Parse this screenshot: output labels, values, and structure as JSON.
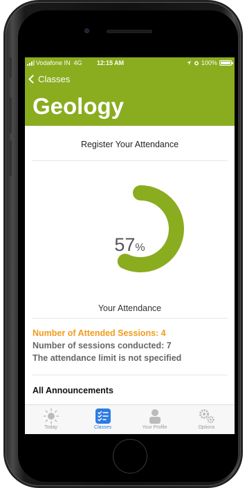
{
  "status_bar": {
    "carrier": "Vodafone IN",
    "network": "4G",
    "time": "12:15 AM",
    "battery": "100%"
  },
  "nav": {
    "back_label": "Classes"
  },
  "header": {
    "title": "Geology"
  },
  "register_label": "Register Your Attendance",
  "attendance": {
    "percent": 57,
    "percent_number": "57",
    "percent_symbol": "%",
    "caption": "Your Attendance",
    "attended_sessions": "Number of Attended Sessions: 4",
    "conducted_sessions": "Number of sessions conducted: 7",
    "limit_note": "The attendance limit is not specified"
  },
  "announcements_heading": "All Announcements",
  "colors": {
    "brand": "#8aac1f",
    "accent_orange": "#f29b1b",
    "tab_active": "#2d7be5"
  },
  "tabs": [
    {
      "label": "Today",
      "icon": "sun-icon"
    },
    {
      "label": "Classes",
      "icon": "checklist-icon",
      "active": true
    },
    {
      "label": "Your Profile",
      "icon": "person-icon"
    },
    {
      "label": "Options",
      "icon": "gears-icon"
    }
  ]
}
